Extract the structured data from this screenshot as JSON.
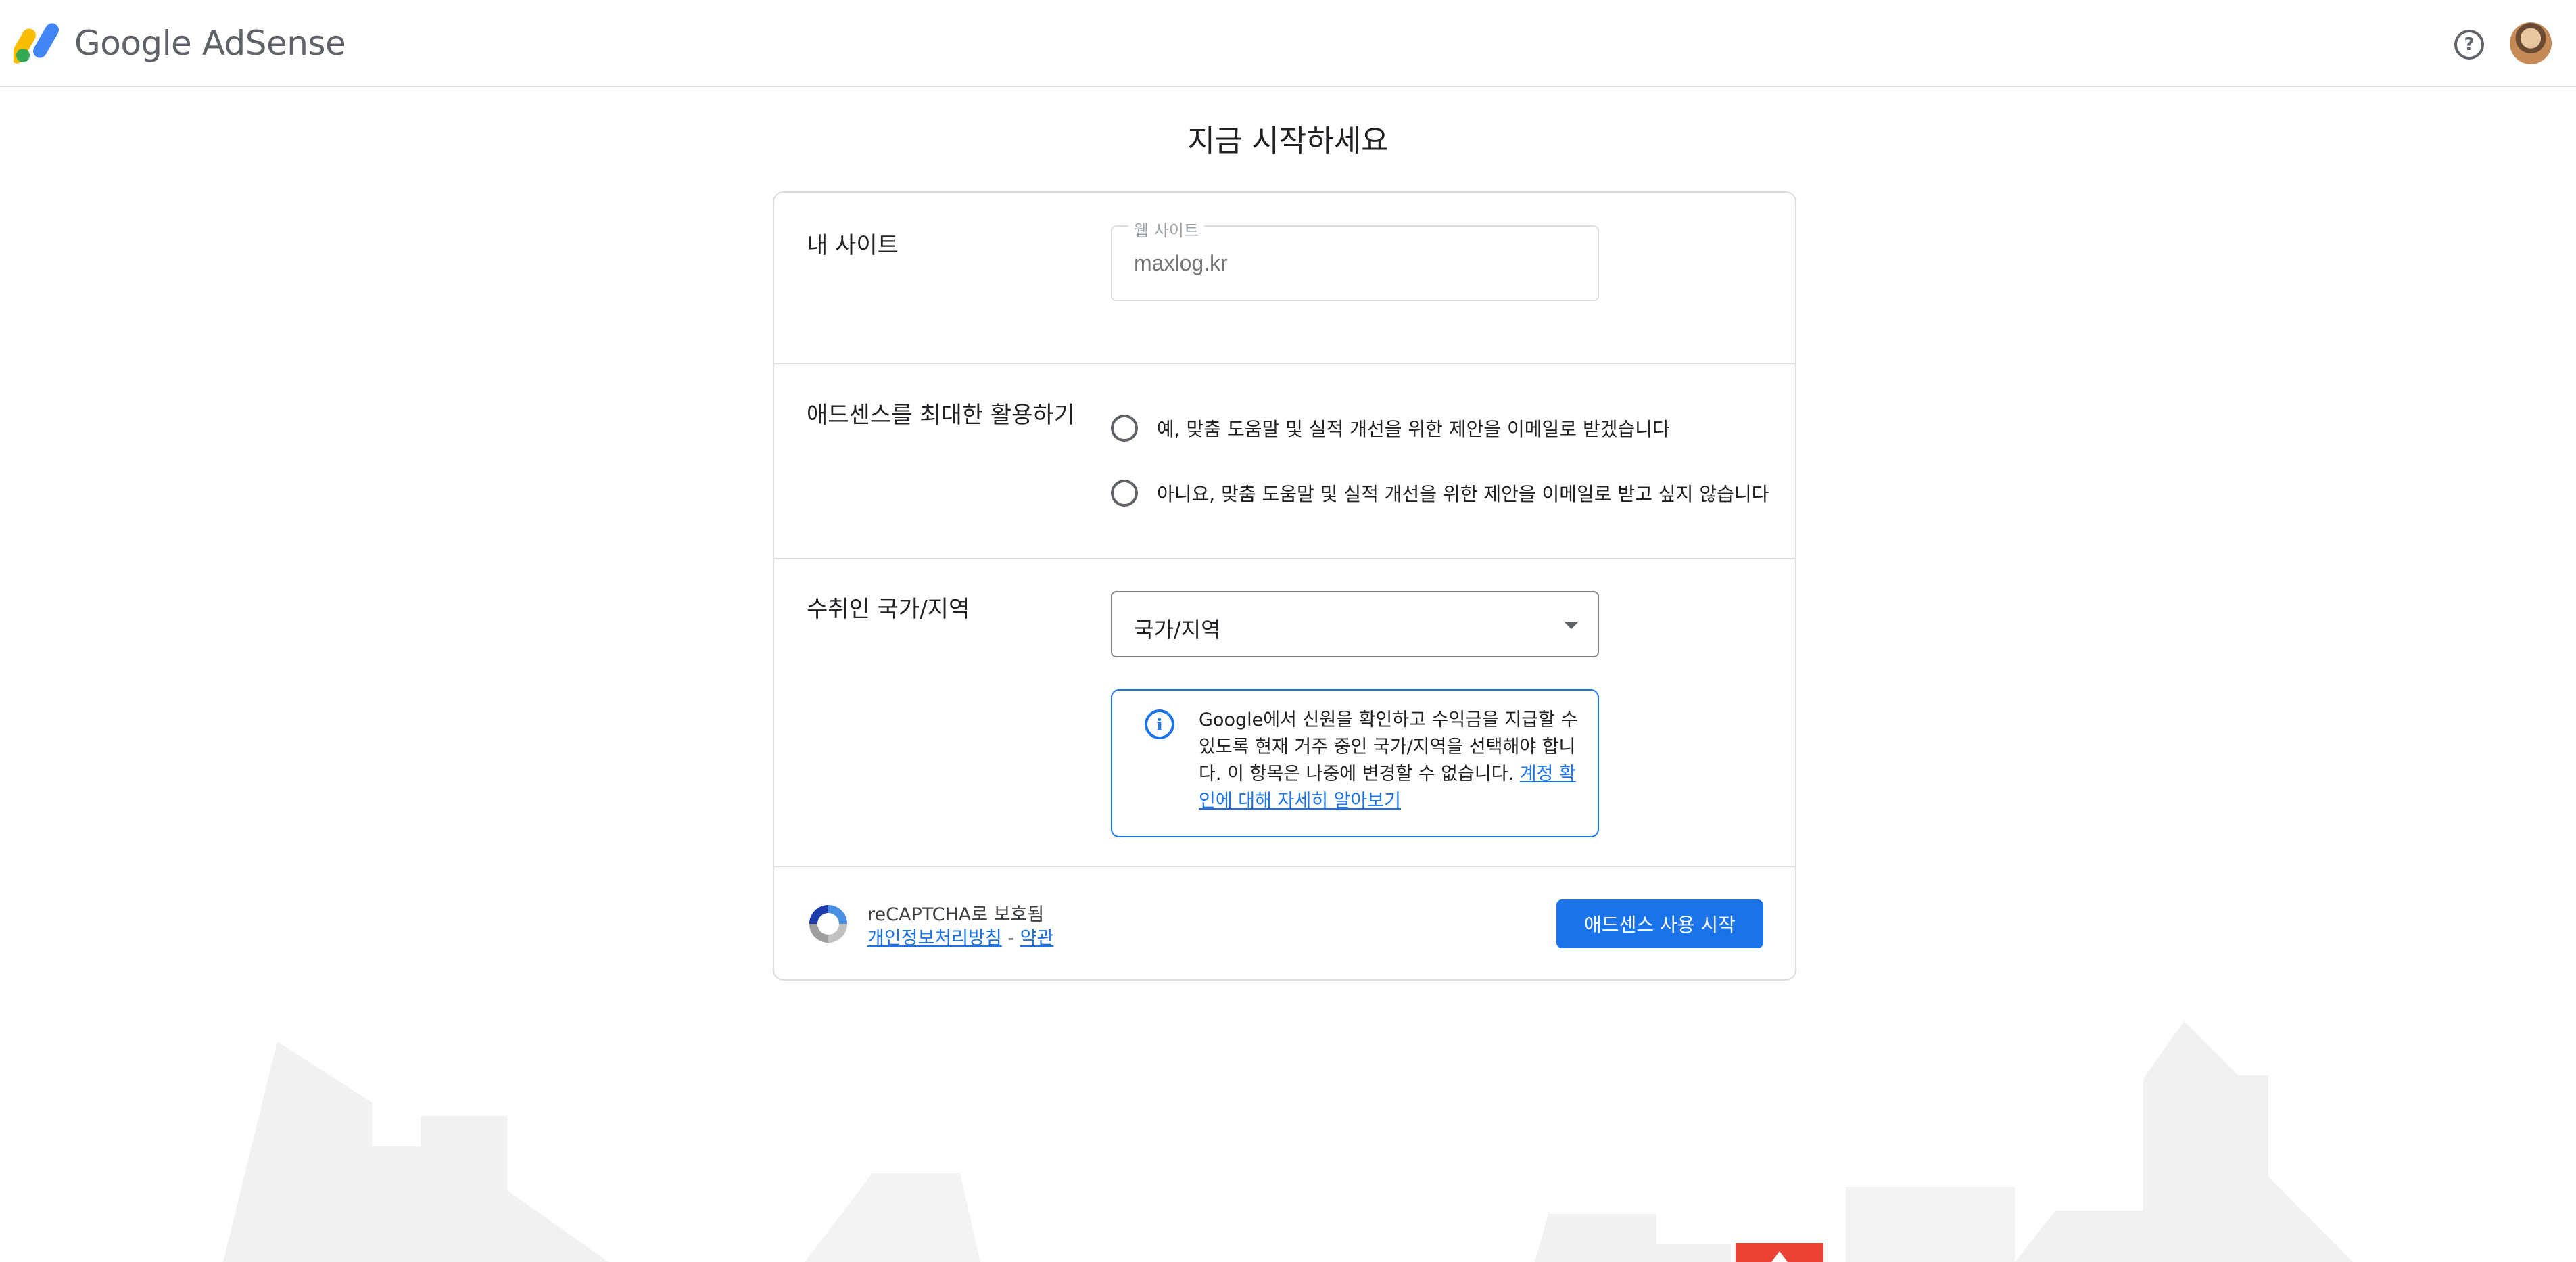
{
  "header": {
    "app_name": "Google AdSense"
  },
  "page": {
    "title": "지금 시작하세요"
  },
  "site_section": {
    "label": "내 사이트",
    "field_label": "웹 사이트",
    "field_placeholder": "maxlog.kr"
  },
  "email_section": {
    "label": "애드센스를 최대한 활용하기",
    "option_yes": "예, 맞춤 도움말 및 실적 개선을 위한 제안을 이메일로 받겠습니다",
    "option_no": "아니요, 맞춤 도움말 및 실적 개선을 위한 제안을 이메일로 받고 싶지 않습니다"
  },
  "country_section": {
    "label": "수취인 국가/지역",
    "select_value": "국가/지역",
    "info_text": "Google에서 신원을 확인하고 수익금을 지급할 수 있도록 현재 거주 중인 국가/지역을 선택해야 합니다. 이 항목은 나중에 변경할 수 없습니다.",
    "info_link": "계정 확인에 대해 자세히 알아보기"
  },
  "footer": {
    "recaptcha_text": "reCAPTCHA로 보호됨",
    "privacy_link": "개인정보처리방침",
    "separator": " - ",
    "terms_link": "약관",
    "start_button": "애드센스 사용 시작"
  },
  "colors": {
    "accent": "#1a73e8",
    "border": "#dadce0",
    "text": "#202124"
  }
}
